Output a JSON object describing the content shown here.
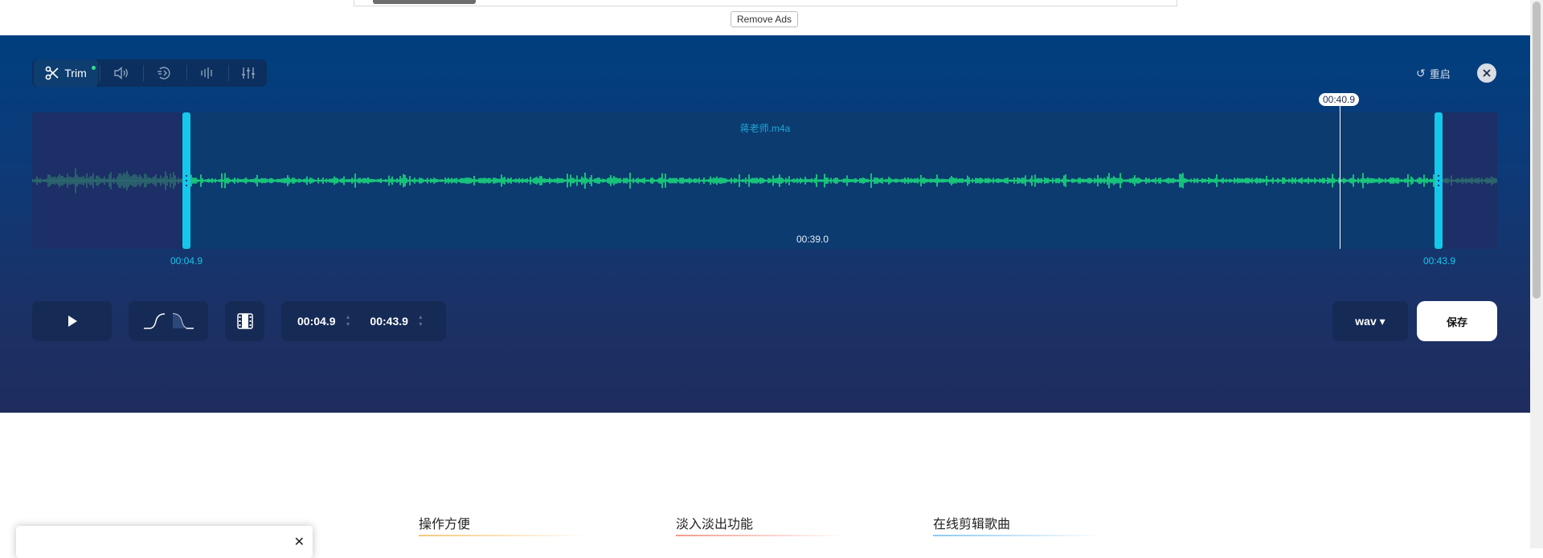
{
  "ad": {
    "remove_ads_label": "Remove Ads"
  },
  "toolbar": {
    "trim_label": "Trim",
    "tools": [
      "volume-icon",
      "speed-icon",
      "equalizer-bars-icon",
      "sliders-icon"
    ],
    "reset_label": "重启"
  },
  "waveform": {
    "file_name": "蒋老师.m4a",
    "playhead_time": "00:40.9",
    "selection_duration": "00:39.0",
    "start_label": "00:04.9",
    "end_label": "00:43.9"
  },
  "controls": {
    "start_time": "00:04.9",
    "end_time": "00:43.9",
    "format": "wav ▾",
    "save_label": "保存"
  },
  "features": [
    {
      "label": "操作方便",
      "color": "#f5c97a"
    },
    {
      "label": "淡入淡出功能",
      "color": "#f29a8c"
    },
    {
      "label": "在线剪辑歌曲",
      "color": "#8cc9f2"
    }
  ],
  "colors": {
    "accent": "#14c8ea",
    "waveform": "#19e07f",
    "editor_bg": "#0d3a78"
  }
}
